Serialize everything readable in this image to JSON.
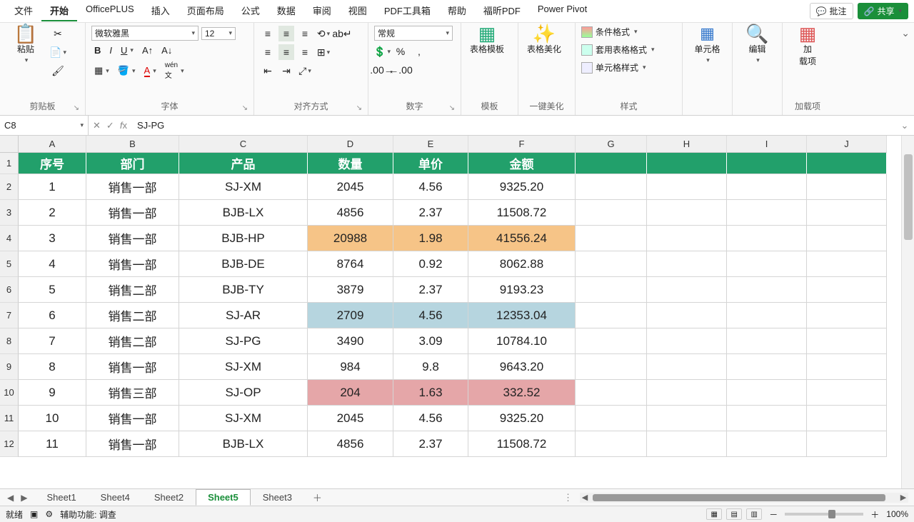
{
  "menu": {
    "items": [
      "文件",
      "开始",
      "OfficePLUS",
      "插入",
      "页面布局",
      "公式",
      "数据",
      "审阅",
      "视图",
      "PDF工具箱",
      "帮助",
      "福昕PDF",
      "Power Pivot"
    ],
    "active_index": 1,
    "comment": "批注",
    "share": "共享"
  },
  "ribbon": {
    "clipboard": {
      "label": "剪贴板",
      "paste": "粘贴"
    },
    "font": {
      "name": "微软雅黑",
      "size": "12",
      "label": "字体"
    },
    "align": {
      "label": "对齐方式"
    },
    "number": {
      "format": "常规",
      "label": "数字"
    },
    "template": {
      "tmpl": "表格模板",
      "beautify": "表格美化",
      "label": "模板",
      "label2": "一键美化"
    },
    "styles": {
      "cond": "条件格式",
      "table": "套用表格格式",
      "cell": "单元格样式",
      "label": "样式"
    },
    "cells": {
      "label": "单元格"
    },
    "edit": {
      "label": "编辑"
    },
    "addins": {
      "label": "加载项",
      "btn": "加\n载项"
    }
  },
  "formula_bar": {
    "cell_ref": "C8",
    "formula": "SJ-PG"
  },
  "columns": [
    {
      "key": "A",
      "w": 95
    },
    {
      "key": "B",
      "w": 130
    },
    {
      "key": "C",
      "w": 180
    },
    {
      "key": "D",
      "w": 120
    },
    {
      "key": "E",
      "w": 105
    },
    {
      "key": "F",
      "w": 150
    },
    {
      "key": "G",
      "w": 100
    },
    {
      "key": "H",
      "w": 112
    },
    {
      "key": "I",
      "w": 112
    },
    {
      "key": "J",
      "w": 112
    }
  ],
  "table": {
    "headers": [
      "序号",
      "部门",
      "产品",
      "数量",
      "单价",
      "金额"
    ],
    "rows": [
      {
        "n": 1,
        "cells": [
          "1",
          "销售一部",
          "SJ-XM",
          "2045",
          "4.56",
          "9325.20"
        ],
        "hl": ""
      },
      {
        "n": 2,
        "cells": [
          "2",
          "销售一部",
          "BJB-LX",
          "4856",
          "2.37",
          "11508.72"
        ],
        "hl": ""
      },
      {
        "n": 3,
        "cells": [
          "3",
          "销售一部",
          "BJB-HP",
          "20988",
          "1.98",
          "41556.24"
        ],
        "hl": "orange"
      },
      {
        "n": 4,
        "cells": [
          "4",
          "销售一部",
          "BJB-DE",
          "8764",
          "0.92",
          "8062.88"
        ],
        "hl": ""
      },
      {
        "n": 5,
        "cells": [
          "5",
          "销售二部",
          "BJB-TY",
          "3879",
          "2.37",
          "9193.23"
        ],
        "hl": ""
      },
      {
        "n": 6,
        "cells": [
          "6",
          "销售二部",
          "SJ-AR",
          "2709",
          "4.56",
          "12353.04"
        ],
        "hl": "blue"
      },
      {
        "n": 7,
        "cells": [
          "7",
          "销售二部",
          "SJ-PG",
          "3490",
          "3.09",
          "10784.10"
        ],
        "hl": ""
      },
      {
        "n": 8,
        "cells": [
          "8",
          "销售一部",
          "SJ-XM",
          "984",
          "9.8",
          "9643.20"
        ],
        "hl": ""
      },
      {
        "n": 9,
        "cells": [
          "9",
          "销售三部",
          "SJ-OP",
          "204",
          "1.63",
          "332.52"
        ],
        "hl": "red"
      },
      {
        "n": 10,
        "cells": [
          "10",
          "销售一部",
          "SJ-XM",
          "2045",
          "4.56",
          "9325.20"
        ],
        "hl": ""
      },
      {
        "n": 11,
        "cells": [
          "11",
          "销售一部",
          "BJB-LX",
          "4856",
          "2.37",
          "11508.72"
        ],
        "hl": ""
      }
    ]
  },
  "sheets": {
    "tabs": [
      "Sheet1",
      "Sheet4",
      "Sheet2",
      "Sheet5",
      "Sheet3"
    ],
    "active_index": 3
  },
  "status": {
    "ready": "就绪",
    "access": "辅助功能: 调查",
    "zoom": "100%"
  }
}
